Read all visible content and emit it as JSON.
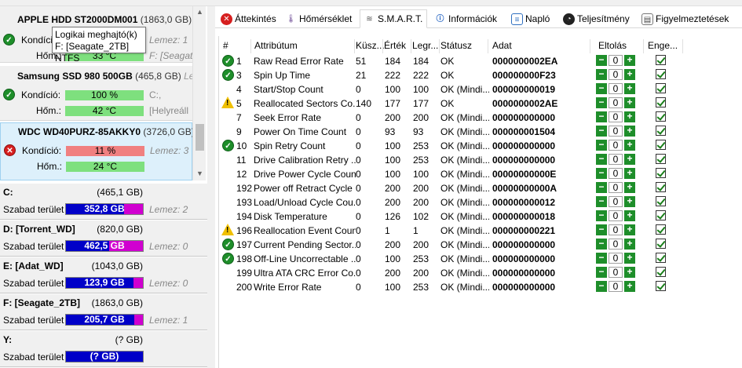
{
  "tooltip": {
    "line1": "Logikai meghajtó(k)",
    "line2": "F: [Seagate_2TB] NTFS"
  },
  "disks": [
    {
      "name": "APPLE HDD ST2000DM001",
      "capacity": "(1863,0 GB)",
      "condition_label": "Kondíció:",
      "condition_value": "",
      "condition_side": "Lemez: 1",
      "temp_label": "Hőm.:",
      "temp_value": "33 °C",
      "temp_side": "F: [Seagate",
      "status": "ok"
    },
    {
      "name": "Samsung SSD 980 500GB",
      "capacity": "(465,8 GB)",
      "capacity_side": "Lem",
      "condition_label": "Kondíció:",
      "condition_value": "100 %",
      "condition_side": "C:,",
      "temp_label": "Hőm.:",
      "temp_value": "42 °C",
      "temp_side": "[Helyreáll",
      "status": "ok"
    },
    {
      "name": "WDC WD40PURZ-85AKKY0",
      "capacity": "(3726,0 GB)",
      "condition_label": "Kondíció:",
      "condition_value": "11 %",
      "condition_side": "Lemez: 3",
      "temp_label": "Hőm.:",
      "temp_value": "24 °C",
      "temp_side": "",
      "status": "bad"
    }
  ],
  "volumes": [
    {
      "name": "C:",
      "capacity": "(465,1 GB)",
      "free_label": "Szabad terület",
      "free_value": "352,8 GB",
      "free_ratio": 0.76,
      "side": "Lemez: 2"
    },
    {
      "name": "D: [Torrent_WD]",
      "capacity": "(820,0 GB)",
      "free_label": "Szabad terület",
      "free_value": "462,5 GB",
      "free_ratio": 0.56,
      "side": "Lemez: 0"
    },
    {
      "name": "E: [Adat_WD]",
      "capacity": "(1043,0 GB)",
      "free_label": "Szabad terület",
      "free_value": "123,9 GB",
      "free_ratio": 0.88,
      "side": "Lemez: 0"
    },
    {
      "name": "F: [Seagate_2TB]",
      "capacity": "(1863,0 GB)",
      "free_label": "Szabad terület",
      "free_value": "205,7 GB",
      "free_ratio": 0.89,
      "side": "Lemez: 1"
    },
    {
      "name": "Y:",
      "capacity": "(? GB)",
      "free_label": "Szabad terület",
      "free_value": "(? GB)",
      "free_ratio": 1.0,
      "side": ""
    }
  ],
  "tabs": [
    {
      "label": "Áttekintés",
      "icon": "x-circle-icon"
    },
    {
      "label": "Hőmérséklet",
      "icon": "thermometer-icon"
    },
    {
      "label": "S.M.A.R.T.",
      "icon": "disk-icon"
    },
    {
      "label": "Információk",
      "icon": "info-icon"
    },
    {
      "label": "Napló",
      "icon": "log-icon"
    },
    {
      "label": "Teljesítmény",
      "icon": "performance-icon"
    },
    {
      "label": "Figyelmeztetések",
      "icon": "warnings-icon"
    }
  ],
  "smart": {
    "headers": {
      "num": "#",
      "attr": "Attribútum",
      "thresh": "Küsz...",
      "value": "Érték",
      "worst": "Legr...",
      "status": "Státusz",
      "data": "Adat",
      "offset": "Eltolás",
      "enable": "Enge..."
    },
    "rows": [
      {
        "icon": "ok",
        "id": "1",
        "attr": "Raw Read Error Rate",
        "thresh": "51",
        "value": "184",
        "worst": "184",
        "status": "OK",
        "data": "0000000002EA",
        "offset": "0"
      },
      {
        "icon": "ok",
        "id": "3",
        "attr": "Spin Up Time",
        "thresh": "21",
        "value": "222",
        "worst": "222",
        "status": "OK",
        "data": "000000000F23",
        "offset": "0"
      },
      {
        "icon": "",
        "id": "4",
        "attr": "Start/Stop Count",
        "thresh": "0",
        "value": "100",
        "worst": "100",
        "status": "OK (Mindi...",
        "data": "000000000019",
        "offset": "0"
      },
      {
        "icon": "warn",
        "id": "5",
        "attr": "Reallocated Sectors Co...",
        "thresh": "140",
        "value": "177",
        "worst": "177",
        "status": "OK",
        "data": "0000000002AE",
        "offset": "0"
      },
      {
        "icon": "",
        "id": "7",
        "attr": "Seek Error Rate",
        "thresh": "0",
        "value": "200",
        "worst": "200",
        "status": "OK (Mindi...",
        "data": "000000000000",
        "offset": "0"
      },
      {
        "icon": "",
        "id": "9",
        "attr": "Power On Time Count",
        "thresh": "0",
        "value": "93",
        "worst": "93",
        "status": "OK (Mindi...",
        "data": "000000001504",
        "offset": "0"
      },
      {
        "icon": "ok",
        "id": "10",
        "attr": "Spin Retry Count",
        "thresh": "0",
        "value": "100",
        "worst": "253",
        "status": "OK (Mindi...",
        "data": "000000000000",
        "offset": "0"
      },
      {
        "icon": "",
        "id": "11",
        "attr": "Drive Calibration Retry ...",
        "thresh": "0",
        "value": "100",
        "worst": "253",
        "status": "OK (Mindi...",
        "data": "000000000000",
        "offset": "0"
      },
      {
        "icon": "",
        "id": "12",
        "attr": "Drive Power Cycle Count",
        "thresh": "0",
        "value": "100",
        "worst": "100",
        "status": "OK (Mindi...",
        "data": "00000000000E",
        "offset": "0"
      },
      {
        "icon": "",
        "id": "192",
        "attr": "Power off Retract Cycle ...",
        "thresh": "0",
        "value": "200",
        "worst": "200",
        "status": "OK (Mindi...",
        "data": "00000000000A",
        "offset": "0"
      },
      {
        "icon": "",
        "id": "193",
        "attr": "Load/Unload Cycle Cou...",
        "thresh": "0",
        "value": "200",
        "worst": "200",
        "status": "OK (Mindi...",
        "data": "000000000012",
        "offset": "0"
      },
      {
        "icon": "",
        "id": "194",
        "attr": "Disk Temperature",
        "thresh": "0",
        "value": "126",
        "worst": "102",
        "status": "OK (Mindi...",
        "data": "000000000018",
        "offset": "0"
      },
      {
        "icon": "warn",
        "id": "196",
        "attr": "Reallocation Event Count",
        "thresh": "0",
        "value": "1",
        "worst": "1",
        "status": "OK (Mindi...",
        "data": "000000000221",
        "offset": "0"
      },
      {
        "icon": "ok",
        "id": "197",
        "attr": "Current Pending Sector...",
        "thresh": "0",
        "value": "200",
        "worst": "200",
        "status": "OK (Mindi...",
        "data": "000000000000",
        "offset": "0"
      },
      {
        "icon": "ok",
        "id": "198",
        "attr": "Off-Line Uncorrectable ...",
        "thresh": "0",
        "value": "100",
        "worst": "253",
        "status": "OK (Mindi...",
        "data": "000000000000",
        "offset": "0"
      },
      {
        "icon": "",
        "id": "199",
        "attr": "Ultra ATA CRC Error Co...",
        "thresh": "0",
        "value": "200",
        "worst": "200",
        "status": "OK (Mindi...",
        "data": "000000000000",
        "offset": "0"
      },
      {
        "icon": "",
        "id": "200",
        "attr": "Write Error Rate",
        "thresh": "0",
        "value": "100",
        "worst": "253",
        "status": "OK (Mindi...",
        "data": "000000000000",
        "offset": "0"
      }
    ]
  },
  "colors": {
    "ok_green": "#1e8e2a",
    "bad_red": "#d61f1f",
    "bar_green": "#7ee07e",
    "bar_red": "#f08080",
    "vol_blue": "#0000c8",
    "vol_magenta": "#d000d0"
  }
}
